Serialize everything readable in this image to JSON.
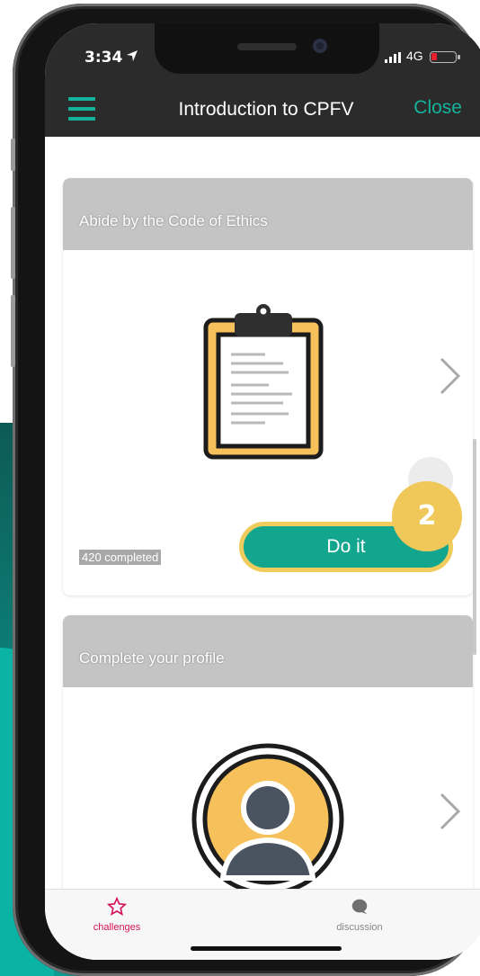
{
  "status_bar": {
    "time": "3:34",
    "network": "4G"
  },
  "nav": {
    "title": "Introduction to CPFV",
    "close_label": "Close"
  },
  "challenges": [
    {
      "title": "Abide by the Code of Ethics",
      "completed_text": "420 completed",
      "action_label": "Do it",
      "badge": "2",
      "icon": "clipboard-icon"
    },
    {
      "title": "Complete your profile",
      "icon": "profile-avatar-icon"
    }
  ],
  "tabbar": {
    "tabs": [
      {
        "label": "challenges",
        "icon": "star-icon",
        "active": true
      },
      {
        "label": "discussion",
        "icon": "chat-bubble-icon",
        "active": false
      }
    ]
  },
  "colors": {
    "accent": "#13b39c",
    "button": "#12a68f",
    "badge": "#f0c85a",
    "active_tab": "#d4145a",
    "header": "#2b2b2b"
  }
}
